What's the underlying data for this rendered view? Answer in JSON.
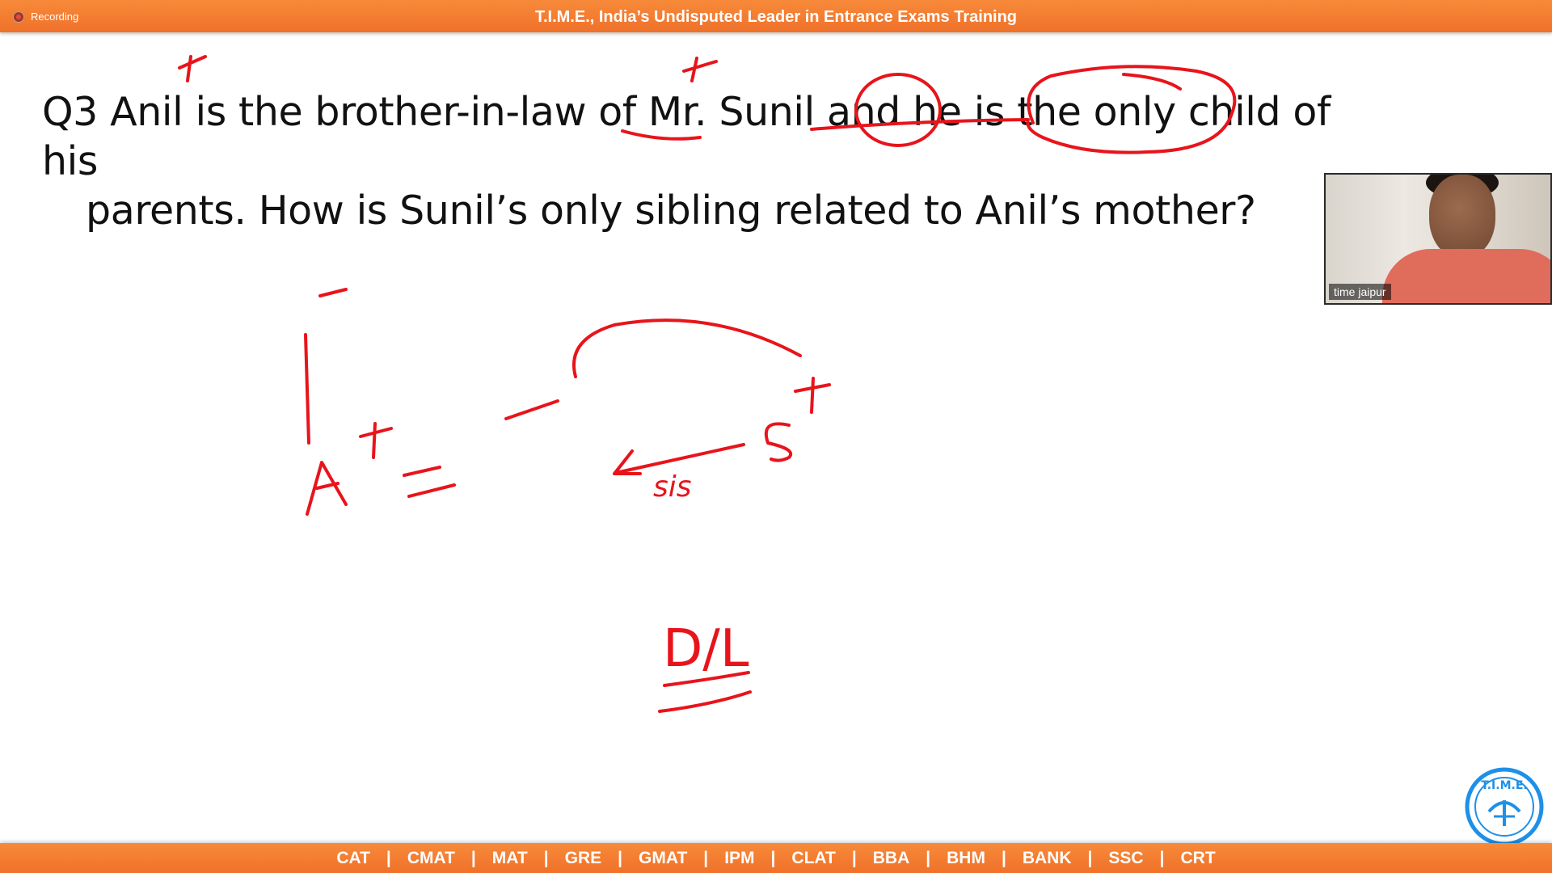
{
  "topbar": {
    "recording_label": "Recording",
    "title": "T.I.M.E., India’s Undisputed Leader in Entrance Exams Training"
  },
  "question": {
    "line1": "Q3 Anil is the brother-in-law of Mr. Sunil and he is the only child of his",
    "line2": "parents. How is Sunil’s only sibling related to Anil’s mother?"
  },
  "annotations": {
    "a_label": "A",
    "s_label": "S",
    "sis_label": "sis",
    "answer_label": "D/L",
    "color": "#e8141b"
  },
  "video": {
    "participant_name": "time jaipur"
  },
  "logo": {
    "text": "T.I.M.E."
  },
  "bottombar": {
    "courses": [
      "CAT",
      "CMAT",
      "MAT",
      "GRE",
      "GMAT",
      "IPM",
      "CLAT",
      "BBA",
      "BHM",
      "BANK",
      "SSC",
      "CRT"
    ],
    "separator": "|"
  },
  "colors": {
    "bar_orange": "#f0712a",
    "ink_red": "#e8141b",
    "logo_blue": "#1e90e8"
  }
}
